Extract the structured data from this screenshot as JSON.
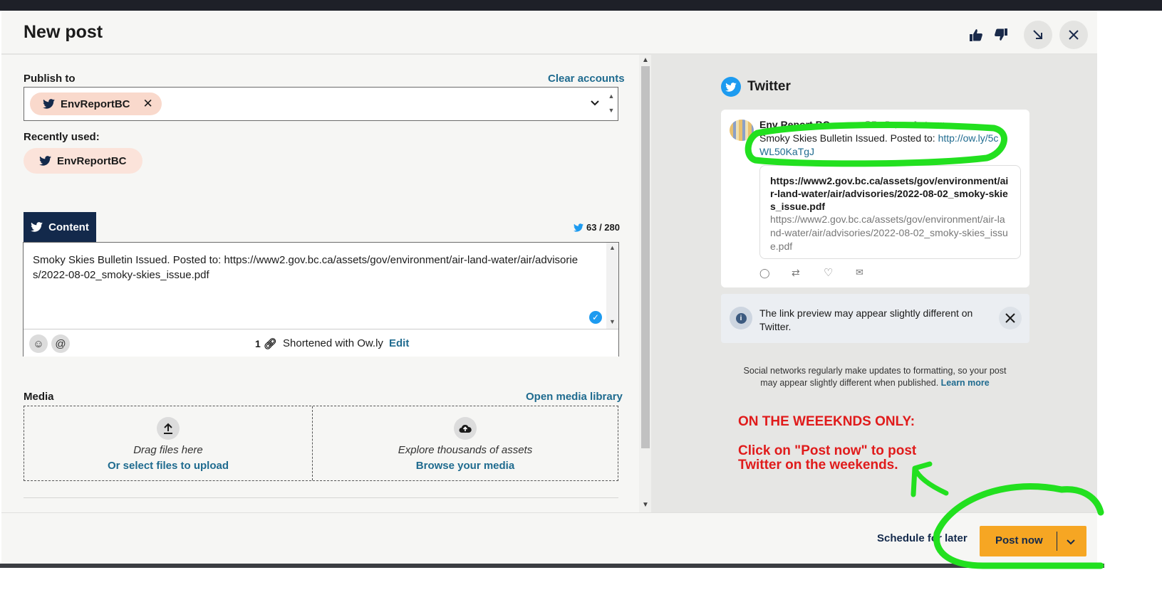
{
  "header": {
    "title": "New post"
  },
  "publish": {
    "label": "Publish to",
    "clear_label": "Clear accounts",
    "selected_account": "EnvReportBC",
    "recent_label": "Recently used:",
    "recent_account": "EnvReportBC"
  },
  "content": {
    "tab_label": "Content",
    "char_count": "63 / 280",
    "text": "Smoky Skies Bulletin Issued. Posted to: https://www2.gov.bc.ca/assets/gov/environment/air-land-water/air/advisories/2022-08-02_smoky-skies_issue.pdf",
    "link_count": "1",
    "shortened_label": "Shortened with Ow.ly",
    "edit_label": "Edit"
  },
  "media": {
    "label": "Media",
    "open_library": "Open media library",
    "drag_text": "Drag files here",
    "select_link": "Or select files to upload",
    "explore_text": "Explore thousands of assets",
    "browse_link": "Browse your media"
  },
  "preview": {
    "network": "Twitter",
    "author_name": "Env Report BC",
    "author_handle": "@EnvRep... • Just now",
    "tweet_text_plain": "Smoky Skies Bulletin Issued. Posted to: ",
    "tweet_link": "http://ow.ly/5cWL50KaTgJ",
    "card_title": "https://www2.gov.bc.ca/assets/gov/environment/air-land-water/air/advisories/2022-08-02_smoky-skies_issue.pdf",
    "card_url": "https://www2.gov.bc.ca/assets/gov/environment/air-land-water/air/advisories/2022-08-02_smoky-skies_issue.pdf",
    "info_text": "The link preview may appear slightly different on Twitter.",
    "disclaimer": "Social networks regularly make updates to formatting, so your post may appear slightly different when published.",
    "learn_more": "Learn more"
  },
  "annotation": {
    "line1": "ON THE WEEEKNDS ONLY:",
    "line2": "Click on \"Post now\" to post",
    "line3": "Twitter on the weekends."
  },
  "footer": {
    "schedule_label": "Schedule for later",
    "post_now_label": "Post now"
  },
  "colors": {
    "accent": "#f6a623",
    "link": "#1f6b8f",
    "navy": "#13294b",
    "twitter": "#1d9bf0",
    "annotation": "#e01b1b",
    "highlight": "#22e01f"
  }
}
